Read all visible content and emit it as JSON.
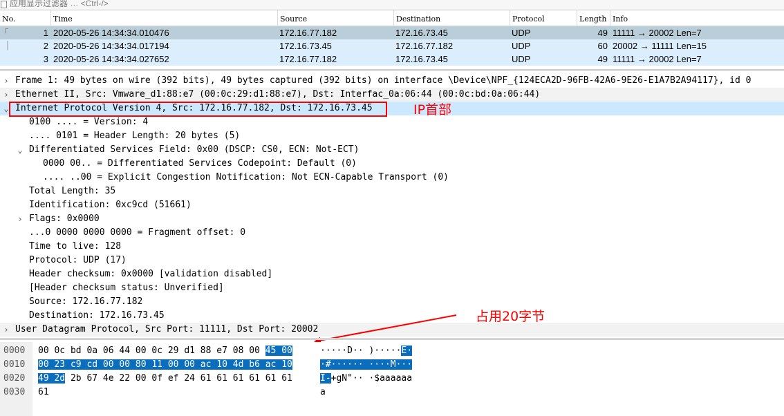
{
  "filter": {
    "placeholder": "应用显示过滤器 … <Ctrl-/>"
  },
  "packet_list": {
    "headers": [
      "No.",
      "Time",
      "Source",
      "Destination",
      "Protocol",
      "Length",
      "Info"
    ],
    "rows": [
      {
        "no": "1",
        "time": "2020-05-26 14:34:34.010476",
        "source": "172.16.77.182",
        "destination": "172.16.73.45",
        "protocol": "UDP",
        "length": "49",
        "info": "11111 → 20002 Len=7"
      },
      {
        "no": "2",
        "time": "2020-05-26 14:34:34.017194",
        "source": "172.16.73.45",
        "destination": "172.16.77.182",
        "protocol": "UDP",
        "length": "60",
        "info": "20002 → 11111 Len=15"
      },
      {
        "no": "3",
        "time": "2020-05-26 14:34:34.027652",
        "source": "172.16.77.182",
        "destination": "172.16.73.45",
        "protocol": "UDP",
        "length": "49",
        "info": "11111 → 20002 Len=7"
      }
    ]
  },
  "details": [
    {
      "text": "Frame 1: 49 bytes on wire (392 bits), 49 bytes captured (392 bits) on interface \\Device\\NPF_{124ECA2D-96FB-42A6-9E26-E1A7B2A94117}, id 0",
      "state": "collapsed"
    },
    {
      "text": "Ethernet II, Src: Vmware_d1:88:e7 (00:0c:29:d1:88:e7), Dst: Interfac_0a:06:44 (00:0c:bd:0a:06:44)",
      "state": "collapsed"
    },
    {
      "text": "Internet Protocol Version 4, Src: 172.16.77.182, Dst: 172.16.73.45",
      "state": "expanded"
    },
    {
      "text": "0100 .... = Version: 4",
      "state": "leaf"
    },
    {
      "text": ".... 0101 = Header Length: 20 bytes (5)",
      "state": "leaf"
    },
    {
      "text": "Differentiated Services Field: 0x00 (DSCP: CS0, ECN: Not-ECT)",
      "state": "expanded"
    },
    {
      "text": "0000 00.. = Differentiated Services Codepoint: Default (0)",
      "state": "leaf"
    },
    {
      "text": ".... ..00 = Explicit Congestion Notification: Not ECN-Capable Transport (0)",
      "state": "leaf"
    },
    {
      "text": "Total Length: 35",
      "state": "leaf"
    },
    {
      "text": "Identification: 0xc9cd (51661)",
      "state": "leaf"
    },
    {
      "text": "Flags: 0x0000",
      "state": "collapsed"
    },
    {
      "text": "...0 0000 0000 0000 = Fragment offset: 0",
      "state": "leaf"
    },
    {
      "text": "Time to live: 128",
      "state": "leaf"
    },
    {
      "text": "Protocol: UDP (17)",
      "state": "leaf"
    },
    {
      "text": "Header checksum: 0x0000 [validation disabled]",
      "state": "leaf"
    },
    {
      "text": "[Header checksum status: Unverified]",
      "state": "leaf"
    },
    {
      "text": "Source: 172.16.77.182",
      "state": "leaf"
    },
    {
      "text": "Destination: 172.16.73.45",
      "state": "leaf"
    },
    {
      "text": "User Datagram Protocol, Src Port: 11111, Dst Port: 20002",
      "state": "collapsed"
    }
  ],
  "annotations": {
    "ip_header": "IP首部",
    "size_note": "占用20字节"
  },
  "hex": [
    {
      "offset": "0000",
      "plain": "00 0c bd 0a 06 44 00 0c  29 d1 88 e7 08 00 ",
      "hl": "45 00",
      "hl_first": false,
      "rest": "",
      "ascii_plain": "·····D·· )·····",
      "ascii_hl": "E·",
      "ascii_hl_first": false,
      "ascii_rest": ""
    },
    {
      "offset": "0010",
      "plain": "",
      "hl": "00 23 c9 cd 00 00 80 11  00 00 ac 10 4d b6 ac 10",
      "hl_first": true,
      "rest": "",
      "ascii_plain": "",
      "ascii_hl": "·#······ ····M···",
      "ascii_hl_first": true,
      "ascii_rest": ""
    },
    {
      "offset": "0020",
      "plain": "",
      "hl": "49 2d",
      "hl_first": true,
      "rest": " 2b 67 4e 22 00 0f  ef 24 61 61 61 61 61 61",
      "ascii_plain": "",
      "ascii_hl": "I-",
      "ascii_hl_first": true,
      "ascii_rest": "+gN\"·· ·$aaaaaa"
    },
    {
      "offset": "0030",
      "plain": "61",
      "hl": "",
      "hl_first": false,
      "rest": "",
      "ascii_plain": "a",
      "ascii_hl": "",
      "ascii_hl_first": false,
      "ascii_rest": ""
    }
  ],
  "colors": {
    "selected_row": "#b9ced8",
    "row2": "#dceefc",
    "udp_row": "#daeeff",
    "highlight_bytes": "#0a6ebd",
    "annotation_red": "#ff0000"
  }
}
